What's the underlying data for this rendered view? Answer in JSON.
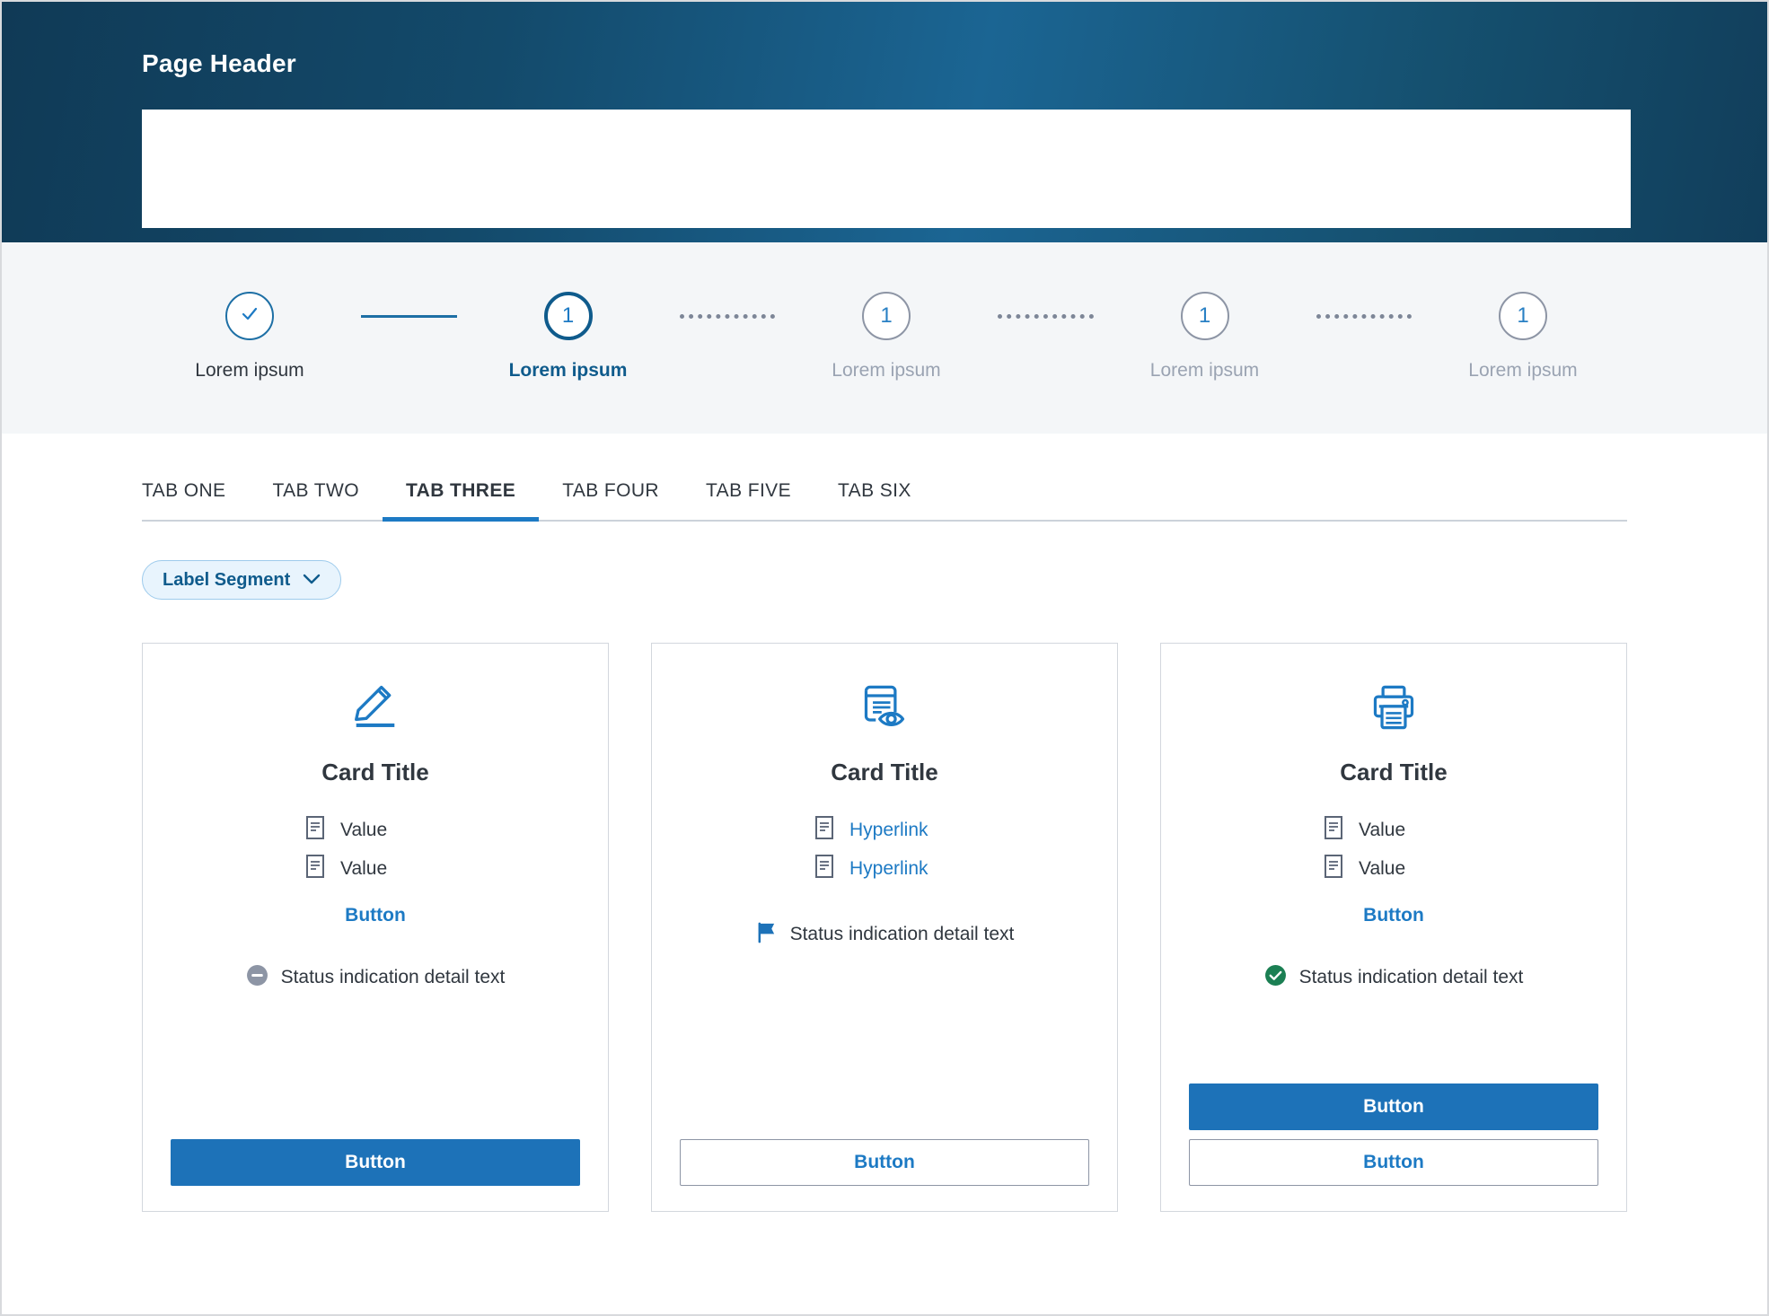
{
  "header": {
    "title": "Page Header"
  },
  "stepper": {
    "steps": [
      {
        "label": "Lorem ipsum",
        "marker": "check",
        "state": "done"
      },
      {
        "label": "Lorem ipsum",
        "marker": "1",
        "state": "active"
      },
      {
        "label": "Lorem ipsum",
        "marker": "1",
        "state": "upcoming"
      },
      {
        "label": "Lorem ipsum",
        "marker": "1",
        "state": "upcoming"
      },
      {
        "label": "Lorem ipsum",
        "marker": "1",
        "state": "upcoming"
      }
    ],
    "connectors": [
      "solid",
      "dotted",
      "dotted",
      "dotted"
    ]
  },
  "tabs": [
    {
      "label": "TAB ONE",
      "active": false
    },
    {
      "label": "TAB TWO",
      "active": false
    },
    {
      "label": "TAB THREE",
      "active": true
    },
    {
      "label": "TAB FOUR",
      "active": false
    },
    {
      "label": "TAB FIVE",
      "active": false
    },
    {
      "label": "TAB SIX",
      "active": false
    }
  ],
  "segment": {
    "label": "Label Segment",
    "icon": "chevron-down-icon"
  },
  "cards": [
    {
      "icon": "pencil-edit-icon",
      "title": "Card Title",
      "rows": [
        {
          "icon": "document-icon",
          "text": "Value",
          "link": false
        },
        {
          "icon": "document-icon",
          "text": "Value",
          "link": false
        }
      ],
      "link_button": "Button",
      "status": {
        "icon": "minus-circle-icon",
        "text": "Status indication detail text",
        "color": "#8d95a5"
      },
      "actions": [
        {
          "label": "Button",
          "variant": "primary"
        }
      ]
    },
    {
      "icon": "document-preview-icon",
      "title": "Card Title",
      "rows": [
        {
          "icon": "document-icon",
          "text": "Hyperlink",
          "link": true
        },
        {
          "icon": "document-icon",
          "text": "Hyperlink",
          "link": true
        }
      ],
      "link_button": "",
      "status": {
        "icon": "flag-icon",
        "text": "Status indication detail text",
        "color": "#1d72b8"
      },
      "actions": [
        {
          "label": "Button",
          "variant": "secondary"
        }
      ]
    },
    {
      "icon": "printer-icon",
      "title": "Card Title",
      "rows": [
        {
          "icon": "document-icon",
          "text": "Value",
          "link": false
        },
        {
          "icon": "document-icon",
          "text": "Value",
          "link": false
        }
      ],
      "link_button": "Button",
      "status": {
        "icon": "check-circle-icon",
        "text": "Status indication detail text",
        "color": "#1b7f53"
      },
      "actions": [
        {
          "label": "Button",
          "variant": "primary"
        },
        {
          "label": "Button",
          "variant": "secondary"
        }
      ]
    }
  ],
  "colors": {
    "brand_dark": "#103a56",
    "brand_mid": "#1b6593",
    "accent_blue": "#1d7ac4",
    "primary_button": "#1d72b8",
    "active_step": "#0f5b8c",
    "muted_gray": "#8d95a5",
    "success_green": "#1b7f53",
    "band_gray": "#f4f6f8",
    "text_dark": "#30373f"
  }
}
